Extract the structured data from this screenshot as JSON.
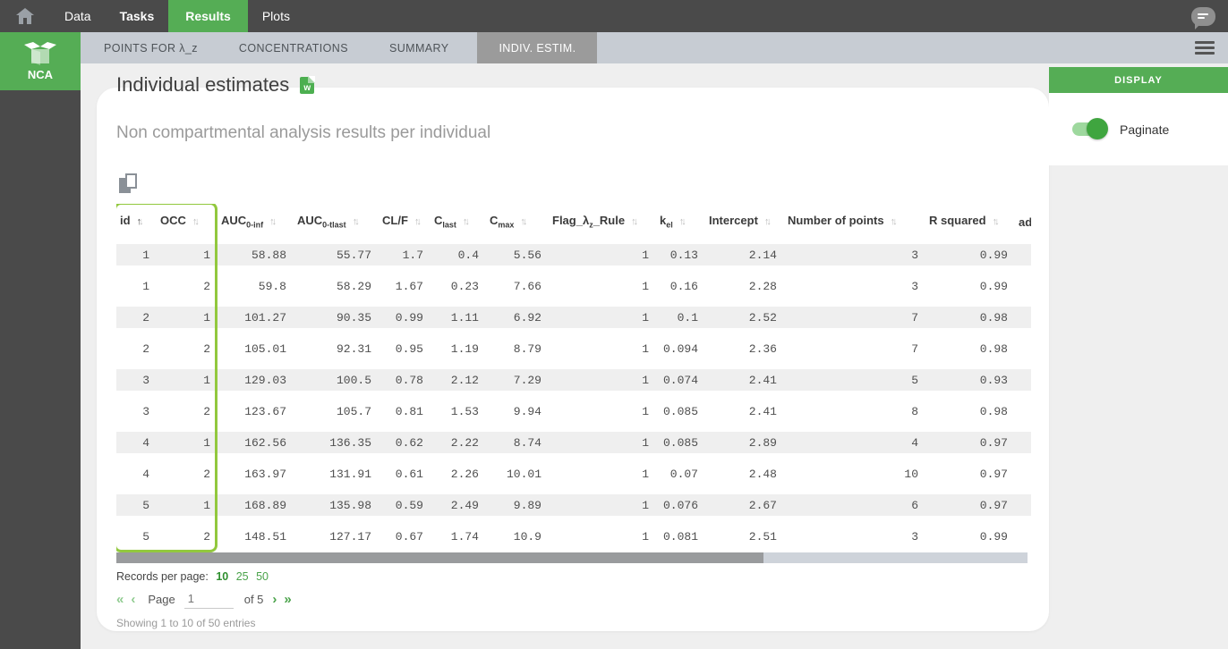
{
  "colors": {
    "brand_green": "#55ad55",
    "highlight_green": "#92c83e",
    "topbar_gray": "#4a4a4a",
    "tabbar_gray": "#c7ccd3",
    "active_tab_gray": "#9b9b9b",
    "row_stripe": "#efefef",
    "toggle_green": "#3fa53f"
  },
  "topnav": {
    "items": [
      "Data",
      "Tasks",
      "Results",
      "Plots"
    ],
    "active": "Results"
  },
  "sidebar": {
    "module": "NCA"
  },
  "tabs": {
    "items": [
      "POINTS FOR λ_z",
      "CONCENTRATIONS",
      "SUMMARY",
      "INDIV. ESTIM."
    ],
    "active": "INDIV. ESTIM."
  },
  "page": {
    "title": "Individual estimates",
    "word_icon_letter": "w",
    "subtitle": "Non compartmental analysis results per individual"
  },
  "display_panel": {
    "header": "DISPLAY",
    "paginate_label": "Paginate",
    "paginate_on": true
  },
  "table": {
    "columns": [
      {
        "pre": "id",
        "sub": "",
        "post": "",
        "sorted": "asc"
      },
      {
        "pre": "OCC",
        "sub": "",
        "post": ""
      },
      {
        "pre": "AUC",
        "sub": "0-inf",
        "post": ""
      },
      {
        "pre": "AUC",
        "sub": "0-tlast",
        "post": ""
      },
      {
        "pre": "CL/F",
        "sub": "",
        "post": ""
      },
      {
        "pre": "C",
        "sub": "last",
        "post": ""
      },
      {
        "pre": "C",
        "sub": "max",
        "post": ""
      },
      {
        "pre": "Flag_λ",
        "sub": "z",
        "post": "_Rule"
      },
      {
        "pre": "k",
        "sub": "el",
        "post": ""
      },
      {
        "pre": "Intercept",
        "sub": "",
        "post": ""
      },
      {
        "pre": "Number of points",
        "sub": "",
        "post": ""
      },
      {
        "pre": "R squared",
        "sub": "",
        "post": ""
      },
      {
        "pre": "ad",
        "sub": "",
        "post": ""
      }
    ],
    "rows": [
      [
        "1",
        "1",
        "58.88",
        "55.77",
        "1.7",
        "0.4",
        "5.56",
        "1",
        "0.13",
        "2.14",
        "3",
        "0.99",
        ""
      ],
      [
        "1",
        "2",
        "59.8",
        "58.29",
        "1.67",
        "0.23",
        "7.66",
        "1",
        "0.16",
        "2.28",
        "3",
        "0.99",
        ""
      ],
      [
        "2",
        "1",
        "101.27",
        "90.35",
        "0.99",
        "1.11",
        "6.92",
        "1",
        "0.1",
        "2.52",
        "7",
        "0.98",
        ""
      ],
      [
        "2",
        "2",
        "105.01",
        "92.31",
        "0.95",
        "1.19",
        "8.79",
        "1",
        "0.094",
        "2.36",
        "7",
        "0.98",
        ""
      ],
      [
        "3",
        "1",
        "129.03",
        "100.5",
        "0.78",
        "2.12",
        "7.29",
        "1",
        "0.074",
        "2.41",
        "5",
        "0.93",
        ""
      ],
      [
        "3",
        "2",
        "123.67",
        "105.7",
        "0.81",
        "1.53",
        "9.94",
        "1",
        "0.085",
        "2.41",
        "8",
        "0.98",
        ""
      ],
      [
        "4",
        "1",
        "162.56",
        "136.35",
        "0.62",
        "2.22",
        "8.74",
        "1",
        "0.085",
        "2.89",
        "4",
        "0.97",
        ""
      ],
      [
        "4",
        "2",
        "163.97",
        "131.91",
        "0.61",
        "2.26",
        "10.01",
        "1",
        "0.07",
        "2.48",
        "10",
        "0.97",
        ""
      ],
      [
        "5",
        "1",
        "168.89",
        "135.98",
        "0.59",
        "2.49",
        "9.89",
        "1",
        "0.076",
        "2.67",
        "6",
        "0.97",
        ""
      ],
      [
        "5",
        "2",
        "148.51",
        "127.17",
        "0.67",
        "1.74",
        "10.9",
        "1",
        "0.081",
        "2.51",
        "3",
        "0.99",
        ""
      ]
    ]
  },
  "footer": {
    "records_label": "Records per page:",
    "records_options": [
      "10",
      "25",
      "50"
    ],
    "records_active": "10",
    "first_btn": "«",
    "prev_btn": "‹",
    "page_label": "Page",
    "page_value": "1",
    "of_label": "of 5",
    "next_btn": "›",
    "last_btn": "»",
    "showing": "Showing 1 to 10 of 50 entries"
  }
}
